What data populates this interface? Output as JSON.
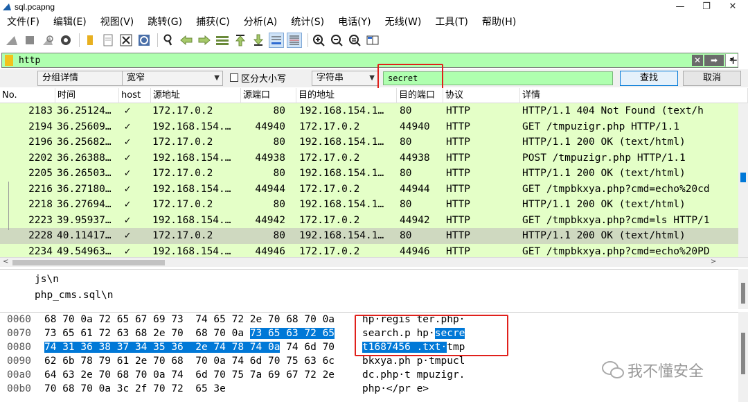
{
  "window": {
    "title": "sql.pcapng",
    "min": "—",
    "restore": "❐",
    "close": "✕"
  },
  "menu": [
    "文件(F)",
    "编辑(E)",
    "视图(V)",
    "跳转(G)",
    "捕获(C)",
    "分析(A)",
    "统计(S)",
    "电话(Y)",
    "无线(W)",
    "工具(T)",
    "帮助(H)"
  ],
  "toolbar_icons": [
    "shark-fin-start-icon",
    "stop-icon",
    "restart-icon",
    "options-gear-icon",
    "open-folder-icon",
    "file-icon",
    "close-file-icon",
    "reload-icon",
    "find-icon",
    "go-back-icon",
    "go-forward-icon",
    "go-to-packet-icon",
    "go-first-icon",
    "go-last-icon",
    "autoscroll-icon",
    "colorize-icon",
    "zoom-in-icon",
    "zoom-out-icon",
    "zoom-reset-icon",
    "resize-columns-icon"
  ],
  "display_filter": {
    "value": "http",
    "clear": "✕",
    "apply": "➡",
    "dropdown": "▾",
    "add": "+"
  },
  "find_bar": {
    "search_in": "分组详情",
    "char_width": "宽窄",
    "case_sensitive_label": "区分大小写",
    "search_type": "字符串",
    "search_value": "secret",
    "find_button": "查找",
    "cancel_button": "取消"
  },
  "packet_list": {
    "columns": [
      "No.",
      "时间",
      "host",
      "源地址",
      "源端口",
      "目的地址",
      "目的端口",
      "协议",
      "详情"
    ],
    "rows": [
      {
        "no": "2183",
        "time": "36.25124…",
        "host": "✓",
        "src": "172.17.0.2",
        "sport": "80",
        "dst": "192.168.154.1…",
        "dport": "80",
        "proto": "HTTP",
        "info": "HTTP/1.1 404 Not Found  (text/h"
      },
      {
        "no": "2194",
        "time": "36.25609…",
        "host": "✓",
        "src": "192.168.154.…",
        "sport": "44940",
        "dst": "172.17.0.2",
        "dport": "44940",
        "proto": "HTTP",
        "info": "GET /tmpuzigr.php HTTP/1.1"
      },
      {
        "no": "2196",
        "time": "36.25682…",
        "host": "✓",
        "src": "172.17.0.2",
        "sport": "80",
        "dst": "192.168.154.1…",
        "dport": "80",
        "proto": "HTTP",
        "info": "HTTP/1.1 200 OK  (text/html)"
      },
      {
        "no": "2202",
        "time": "36.26388…",
        "host": "✓",
        "src": "192.168.154.…",
        "sport": "44938",
        "dst": "172.17.0.2",
        "dport": "44938",
        "proto": "HTTP",
        "info": "POST /tmpuzigr.php HTTP/1.1"
      },
      {
        "no": "2205",
        "time": "36.26503…",
        "host": "✓",
        "src": "172.17.0.2",
        "sport": "80",
        "dst": "192.168.154.1…",
        "dport": "80",
        "proto": "HTTP",
        "info": "HTTP/1.1 200 OK  (text/html)"
      },
      {
        "no": "2216",
        "time": "36.27180…",
        "host": "✓",
        "src": "192.168.154.…",
        "sport": "44944",
        "dst": "172.17.0.2",
        "dport": "44944",
        "proto": "HTTP",
        "info": "GET /tmpbkxya.php?cmd=echo%20cd"
      },
      {
        "no": "2218",
        "time": "36.27694…",
        "host": "✓",
        "src": "172.17.0.2",
        "sport": "80",
        "dst": "192.168.154.1…",
        "dport": "80",
        "proto": "HTTP",
        "info": "HTTP/1.1 200 OK  (text/html)"
      },
      {
        "no": "2223",
        "time": "39.95937…",
        "host": "✓",
        "src": "192.168.154.…",
        "sport": "44942",
        "dst": "172.17.0.2",
        "dport": "44942",
        "proto": "HTTP",
        "info": "GET /tmpbkxya.php?cmd=ls HTTP/1"
      },
      {
        "no": "2228",
        "time": "40.11417…",
        "host": "✓",
        "src": "172.17.0.2",
        "sport": "80",
        "dst": "192.168.154.1…",
        "dport": "80",
        "proto": "HTTP",
        "info": "HTTP/1.1 200 OK  (text/html)",
        "selected": true
      },
      {
        "no": "2234",
        "time": "49.54963…",
        "host": "✓",
        "src": "192.168.154.…",
        "sport": "44946",
        "dst": "172.17.0.2",
        "dport": "44946",
        "proto": "HTTP",
        "info": "GET /tmpbkxya.php?cmd=echo%20PD"
      }
    ]
  },
  "details": [
    "js\\n",
    "php_cms.sql\\n"
  ],
  "bytes": [
    {
      "offset": "0060",
      "hex": [
        [
          "68 70 0a 72 65 67 69 73  74 65 72 2e 70 68 70 0a",
          ""
        ]
      ],
      "ascii": [
        [
          "hp·regis ter.php·",
          ""
        ]
      ]
    },
    {
      "offset": "0070",
      "hex": [
        [
          "73 65 61 72 63 68 2e 70  68 70 0a ",
          ""
        ],
        [
          "73 65 63 72 65",
          "hl"
        ]
      ],
      "ascii": [
        [
          "search.p hp·",
          ""
        ],
        [
          "secre",
          "hl"
        ]
      ]
    },
    {
      "offset": "0080",
      "hex": [
        [
          "74 31 36 38 37 34 35 36  2e 74 78 74 0a",
          "hl"
        ],
        [
          " 74 6d 70",
          ""
        ]
      ],
      "ascii": [
        [
          "t1687456 .txt·",
          "hl"
        ],
        [
          "tmp",
          ""
        ]
      ]
    },
    {
      "offset": "0090",
      "hex": [
        [
          "62 6b 78 79 61 2e 70 68  70 0a 74 6d 70 75 63 6c",
          ""
        ]
      ],
      "ascii": [
        [
          "bkxya.ph p·tmpucl",
          ""
        ]
      ]
    },
    {
      "offset": "00a0",
      "hex": [
        [
          "64 63 2e 70 68 70 0a 74  6d 70 75 7a 69 67 72 2e",
          ""
        ]
      ],
      "ascii": [
        [
          "dc.php·t mpuzigr.",
          ""
        ]
      ]
    },
    {
      "offset": "00b0",
      "hex": [
        [
          "70 68 70 0a 3c 2f 70 72  65 3e",
          ""
        ]
      ],
      "ascii": [
        [
          "php·</pr e>",
          ""
        ]
      ]
    }
  ],
  "watermark": "我不懂安全",
  "colors": {
    "row_bg": "#e4ffc7",
    "row_selected": "#cfd9c0",
    "filter_bg": "#afffaf",
    "highlight": "#0078d7",
    "annotation_red": "#e0201b"
  }
}
